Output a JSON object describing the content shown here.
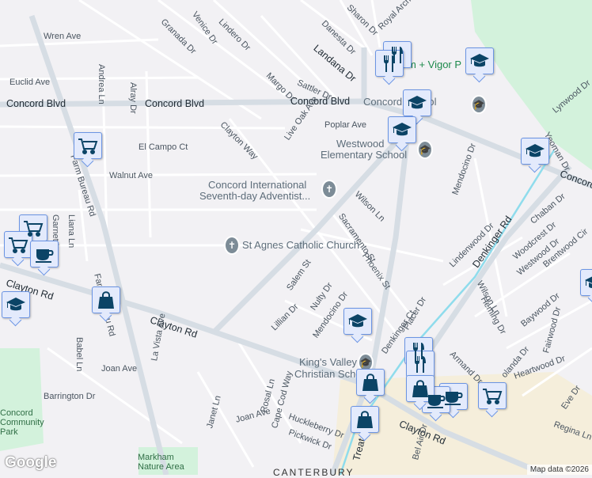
{
  "map": {
    "attribution": "Map data ©2026",
    "logo": "Google",
    "colors": {
      "background": "#f2f1f4",
      "road_major": "#d6dde4",
      "park": "#d3f2dc",
      "commercial": "#f5eedb",
      "water": "#8fdcec",
      "marker_fill": "#e3eafc",
      "marker_border": "#6b94e3",
      "marker_icon": "#0b4466"
    }
  },
  "streets": {
    "wren": "Wren Ave",
    "euclid": "Euclid Ave",
    "concord1": "Concord Blvd",
    "concord2": "Concord Blvd",
    "concord3": "Concord",
    "elcampo": "El Campo Ct",
    "walnut": "Walnut Ave",
    "farm1": "Farm Bureau Rd",
    "farm2": "Farm Bureau Rd",
    "garnet": "Garnet Ln",
    "liana": "Liana Ln",
    "andrea": "Andrea Ln",
    "alray": "Alray Dr",
    "granada": "Granada Dr",
    "venice": "Venice Dr",
    "lindero": "Lindero Dr",
    "margo": "Margo Dr",
    "clayway": "Clayton Way",
    "liveoak": "Live Oak Ave",
    "landana": "Landana Dr",
    "danesta": "Danesta Dr",
    "sharon": "Sharon Dr",
    "royalarch": "Royal Arch Dr",
    "sattler": "Sattler Dr",
    "poplar": "Poplar Ave",
    "wilson1": "Wilson Ln",
    "wilson2": "Wilson Ln",
    "sacramento": "Sacramento St",
    "phoenix": "Phoenix St",
    "salem": "Salem St",
    "nulty": "Nulty Dr",
    "mendocino1": "Mendocino Dr",
    "mendocino2": "Mendocino Dr",
    "lillian": "Lillian Dr",
    "clayton1": "Clayton Rd",
    "clayton2": "Clayton Rd",
    "clayton3": "Clayton Rd",
    "babel": "Babel Ln",
    "lavista": "La Vista Ave",
    "joan1": "Joan Ave",
    "joan2": "Joan Ave",
    "barrington": "Barrington Dr",
    "janet": "Janet Ln",
    "rosal": "Rosal Ln",
    "capecod": "Cape Cod Way",
    "huckleberry": "Huckleberry Dr",
    "pickwick": "Pickwick Dr",
    "treat": "Treat Blvd",
    "belair": "Bel Air Dr",
    "denkct": "Denkinger Ct",
    "denkrd": "Denkinger Rd",
    "placer": "Placer Dr",
    "lindenwood": "Lindenwood Dr",
    "chaban": "Chaban Dr",
    "woodcrest": "Woodcrest Dr",
    "westwood": "Westwood Dr",
    "brentwood": "Brentwood Cir",
    "heming": "Heming Dr",
    "baywood": "Baywood Dr",
    "fairwood": "Fairwood Dr",
    "heartwood": "Heartwood Dr",
    "eve": "Eve Dr",
    "regina": "Regina Ln",
    "lynwood": "Lynwood Dr",
    "yeoman": "Yeoman Dr",
    "armand": "Armand Dr",
    "olanda": "olanda Dr",
    "canterbury": "CANTERBURY"
  },
  "places": {
    "concord_school": "Concord School",
    "westwood_line1": "Westwood",
    "westwood_line2": "Elementary School",
    "adventist_line1": "Concord International",
    "adventist_line2": "Seventh-day Adventist...",
    "st_agnes": "St Agnes Catholic Church",
    "kings_line1": "King's Valley",
    "kings_line2": "Christian School",
    "vigor": "m + Vigor P",
    "markham_line1": "Markham",
    "markham_line2": "Nature Area",
    "park_line1": "Concord",
    "park_line2": "Community",
    "park_line3": "Park"
  },
  "markers": [
    "restaurant",
    "restaurant",
    "school",
    "school",
    "school",
    "school",
    "shopping-cart",
    "shopping-cart",
    "shopping-cart",
    "coffee",
    "school",
    "shopping-bag",
    "school",
    "restaurant",
    "restaurant",
    "shopping-bag",
    "coffee",
    "coffee",
    "shopping-cart",
    "shopping-bag",
    "shopping-bag",
    "school"
  ]
}
